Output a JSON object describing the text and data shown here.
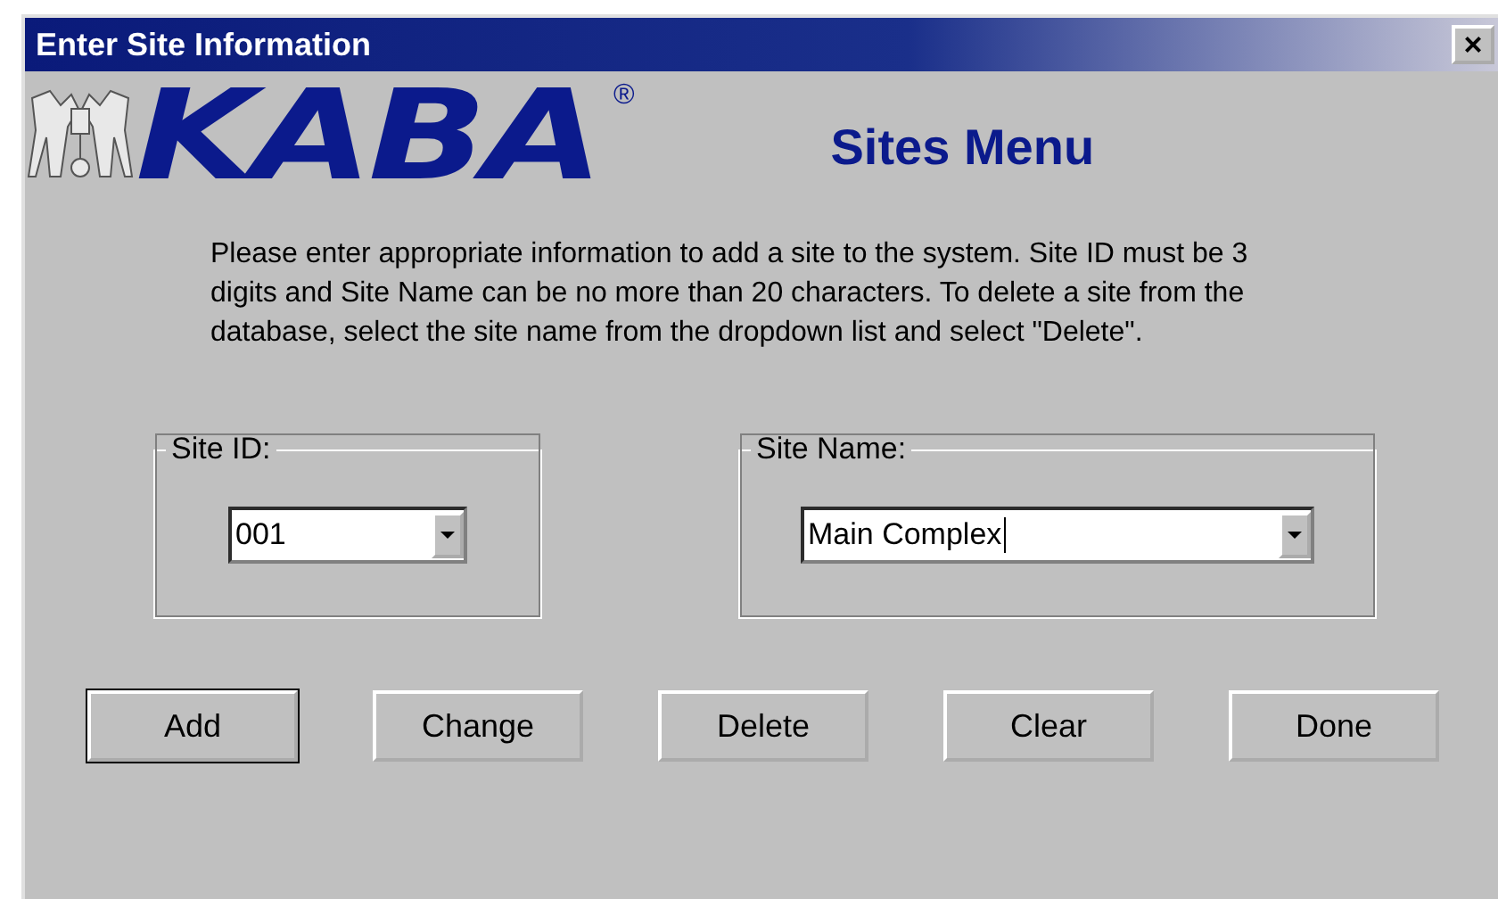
{
  "window": {
    "title": "Enter Site Information",
    "close": "×"
  },
  "logo": {
    "text": "KABA",
    "mark": "®"
  },
  "heading": "Sites Menu",
  "instructions": "Please enter appropriate information to add a site to the system. Site ID must be 3 digits and Site Name can be no more than 20 characters. To delete a site from the database, select the site name from the dropdown list and select \"Delete\".",
  "fields": [
    {
      "label": "Site ID:",
      "value": "001",
      "focused": false
    },
    {
      "label": "Site Name:",
      "value": "Main Complex",
      "focused": true
    }
  ],
  "buttons": [
    {
      "label": "Add",
      "default": true
    },
    {
      "label": "Change",
      "default": false
    },
    {
      "label": "Delete",
      "default": false
    },
    {
      "label": "Clear",
      "default": false
    },
    {
      "label": "Done",
      "default": false
    }
  ]
}
